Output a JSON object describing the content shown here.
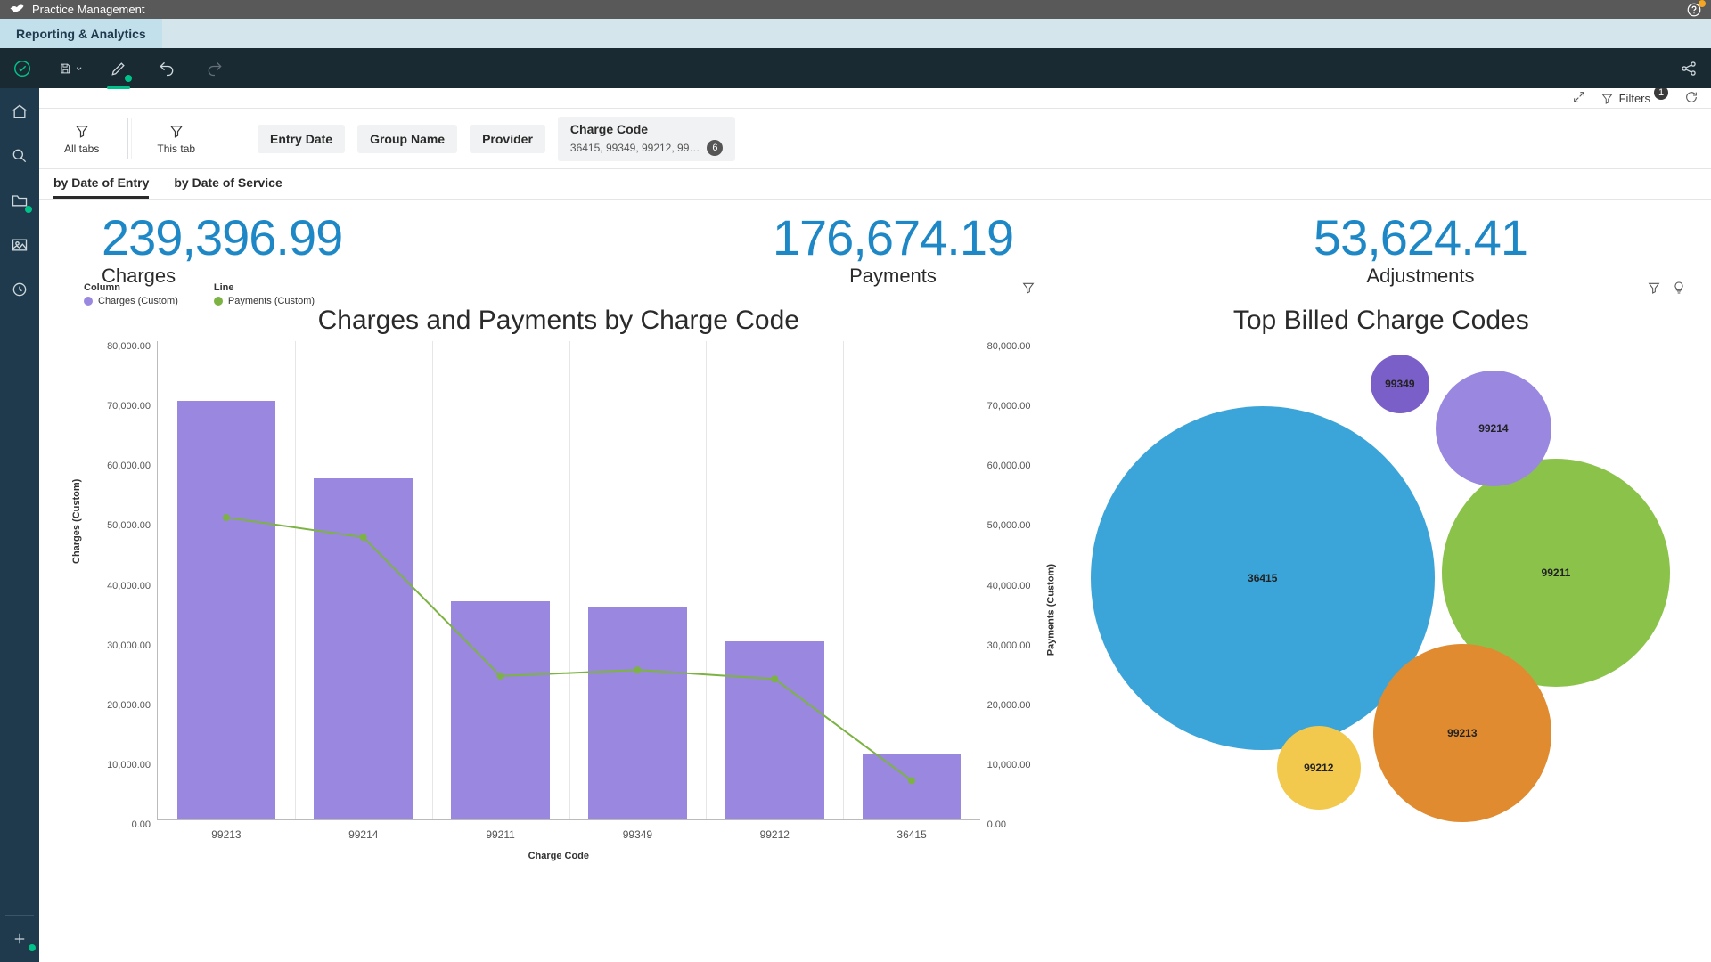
{
  "app": {
    "title": "Practice Management"
  },
  "module_tab": "Reporting & Analytics",
  "pagebar": {
    "filters_label": "Filters",
    "filters_count": "1"
  },
  "scopes": {
    "all": "All tabs",
    "this": "This tab"
  },
  "filter_chips": {
    "entry_date": "Entry Date",
    "group_name": "Group Name",
    "provider": "Provider",
    "charge_code": {
      "label": "Charge Code",
      "detail": "36415, 99349, 99212, 99…",
      "count": "6"
    }
  },
  "subtabs": {
    "entry": "by Date of Entry",
    "service": "by Date of Service"
  },
  "kpis": {
    "charges": {
      "value": "239,396.99",
      "label": "Charges"
    },
    "payments": {
      "value": "176,674.19",
      "label": "Payments"
    },
    "adjustments": {
      "value": "53,624.41",
      "label": "Adjustments"
    }
  },
  "combo": {
    "title": "Charges and Payments by Charge Code",
    "legend_col_hdr": "Column",
    "legend_line_hdr": "Line",
    "legend_col_item": "Charges (Custom)",
    "legend_line_item": "Payments (Custom)",
    "ylabel": "Charges (Custom)",
    "y2label": "Payments (Custom)",
    "xlabel": "Charge Code"
  },
  "bubbles": {
    "title": "Top Billed Charge Codes"
  },
  "colors": {
    "bar": "#9a87e0",
    "line": "#7cb342",
    "b_36415": "#3ba4d8",
    "b_99211": "#8bc34a",
    "b_99213": "#e08b2f",
    "b_99212": "#f2c94c",
    "b_99214": "#9a87e0",
    "b_99349": "#7b5fc9"
  },
  "chart_data": [
    {
      "type": "bar+line",
      "title": "Charges and Payments by Charge Code",
      "xlabel": "Charge Code",
      "ylabel": "Charges (Custom)",
      "y2label": "Payments (Custom)",
      "ylim": [
        0,
        80000
      ],
      "y2lim": [
        0,
        80000
      ],
      "yticks": [
        "0.00",
        "10,000.00",
        "20,000.00",
        "30,000.00",
        "40,000.00",
        "50,000.00",
        "60,000.00",
        "70,000.00",
        "80,000.00"
      ],
      "categories": [
        "99213",
        "99214",
        "99211",
        "99349",
        "99212",
        "36415"
      ],
      "series": [
        {
          "name": "Charges (Custom)",
          "kind": "bar",
          "values": [
            70000,
            57000,
            36500,
            35500,
            29800,
            11000
          ]
        },
        {
          "name": "Payments (Custom)",
          "kind": "line",
          "values": [
            50500,
            47200,
            24000,
            25000,
            23500,
            6500
          ]
        }
      ]
    },
    {
      "type": "bubble",
      "title": "Top Billed Charge Codes",
      "items": [
        {
          "label": "36415",
          "value": 100,
          "color": "#3ba4d8"
        },
        {
          "label": "99211",
          "value": 45,
          "color": "#8bc34a"
        },
        {
          "label": "99213",
          "value": 30,
          "color": "#e08b2f"
        },
        {
          "label": "99214",
          "value": 14,
          "color": "#9a87e0"
        },
        {
          "label": "99212",
          "value": 10,
          "color": "#f2c94c"
        },
        {
          "label": "99349",
          "value": 6,
          "color": "#7b5fc9"
        }
      ]
    }
  ]
}
